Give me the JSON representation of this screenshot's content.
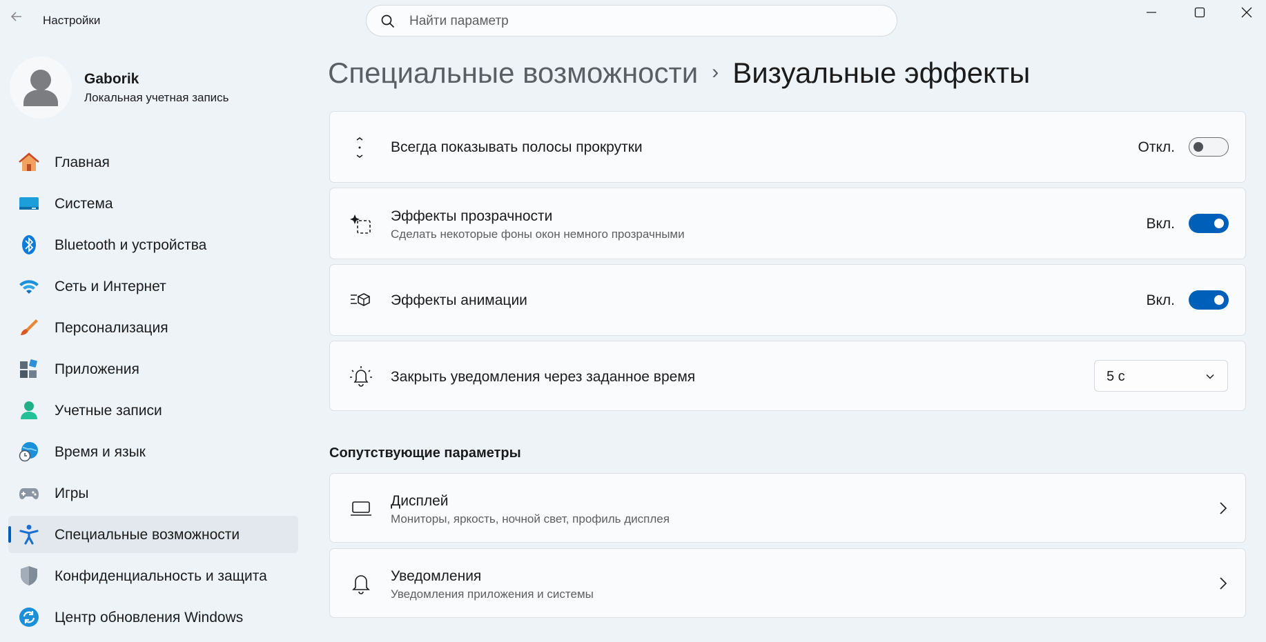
{
  "window": {
    "title": "Настройки",
    "back_icon": "arrow-left-icon",
    "controls": [
      "minimize-icon",
      "maximize-icon",
      "close-icon"
    ]
  },
  "search": {
    "placeholder": "Найти параметр",
    "value": ""
  },
  "profile": {
    "name": "Gaborik",
    "account_type": "Локальная учетная запись"
  },
  "sidebar": {
    "items": [
      {
        "label": "Главная",
        "icon": "home-icon"
      },
      {
        "label": "Система",
        "icon": "system-icon"
      },
      {
        "label": "Bluetooth и устройства",
        "icon": "bluetooth-icon"
      },
      {
        "label": "Сеть и Интернет",
        "icon": "wifi-icon"
      },
      {
        "label": "Персонализация",
        "icon": "brush-icon"
      },
      {
        "label": "Приложения",
        "icon": "apps-icon"
      },
      {
        "label": "Учетные записи",
        "icon": "person-icon"
      },
      {
        "label": "Время и язык",
        "icon": "globe-clock-icon"
      },
      {
        "label": "Игры",
        "icon": "gamepad-icon"
      },
      {
        "label": "Специальные возможности",
        "icon": "accessibility-icon",
        "active": true
      },
      {
        "label": "Конфиденциальность и защита",
        "icon": "shield-icon"
      },
      {
        "label": "Центр обновления Windows",
        "icon": "update-icon"
      }
    ]
  },
  "breadcrumb": {
    "parent": "Специальные возможности",
    "separator": "›",
    "current": "Визуальные эффекты"
  },
  "settings": [
    {
      "title": "Всегда показывать полосы прокрутки",
      "state_label": "Откл.",
      "state": "off",
      "icon": "scrollbar-icon"
    },
    {
      "title": "Эффекты прозрачности",
      "subtitle": "Сделать некоторые фоны окон немного прозрачными",
      "state_label": "Вкл.",
      "state": "on",
      "icon": "transparency-icon"
    },
    {
      "title": "Эффекты анимации",
      "state_label": "Вкл.",
      "state": "on",
      "icon": "animation-icon"
    },
    {
      "title": "Закрыть уведомления через заданное время",
      "dropdown_value": "5 с",
      "icon": "notification-timer-icon"
    }
  ],
  "related": {
    "title": "Сопутствующие параметры",
    "items": [
      {
        "title": "Дисплей",
        "subtitle": "Мониторы, яркость, ночной свет, профиль дисплея",
        "icon": "laptop-icon"
      },
      {
        "title": "Уведомления",
        "subtitle": "Уведомления приложения и системы",
        "icon": "bell-icon"
      }
    ]
  },
  "colors": {
    "accent": "#005fb8",
    "background": "#eef3f8",
    "card": "#f9fbfd"
  }
}
